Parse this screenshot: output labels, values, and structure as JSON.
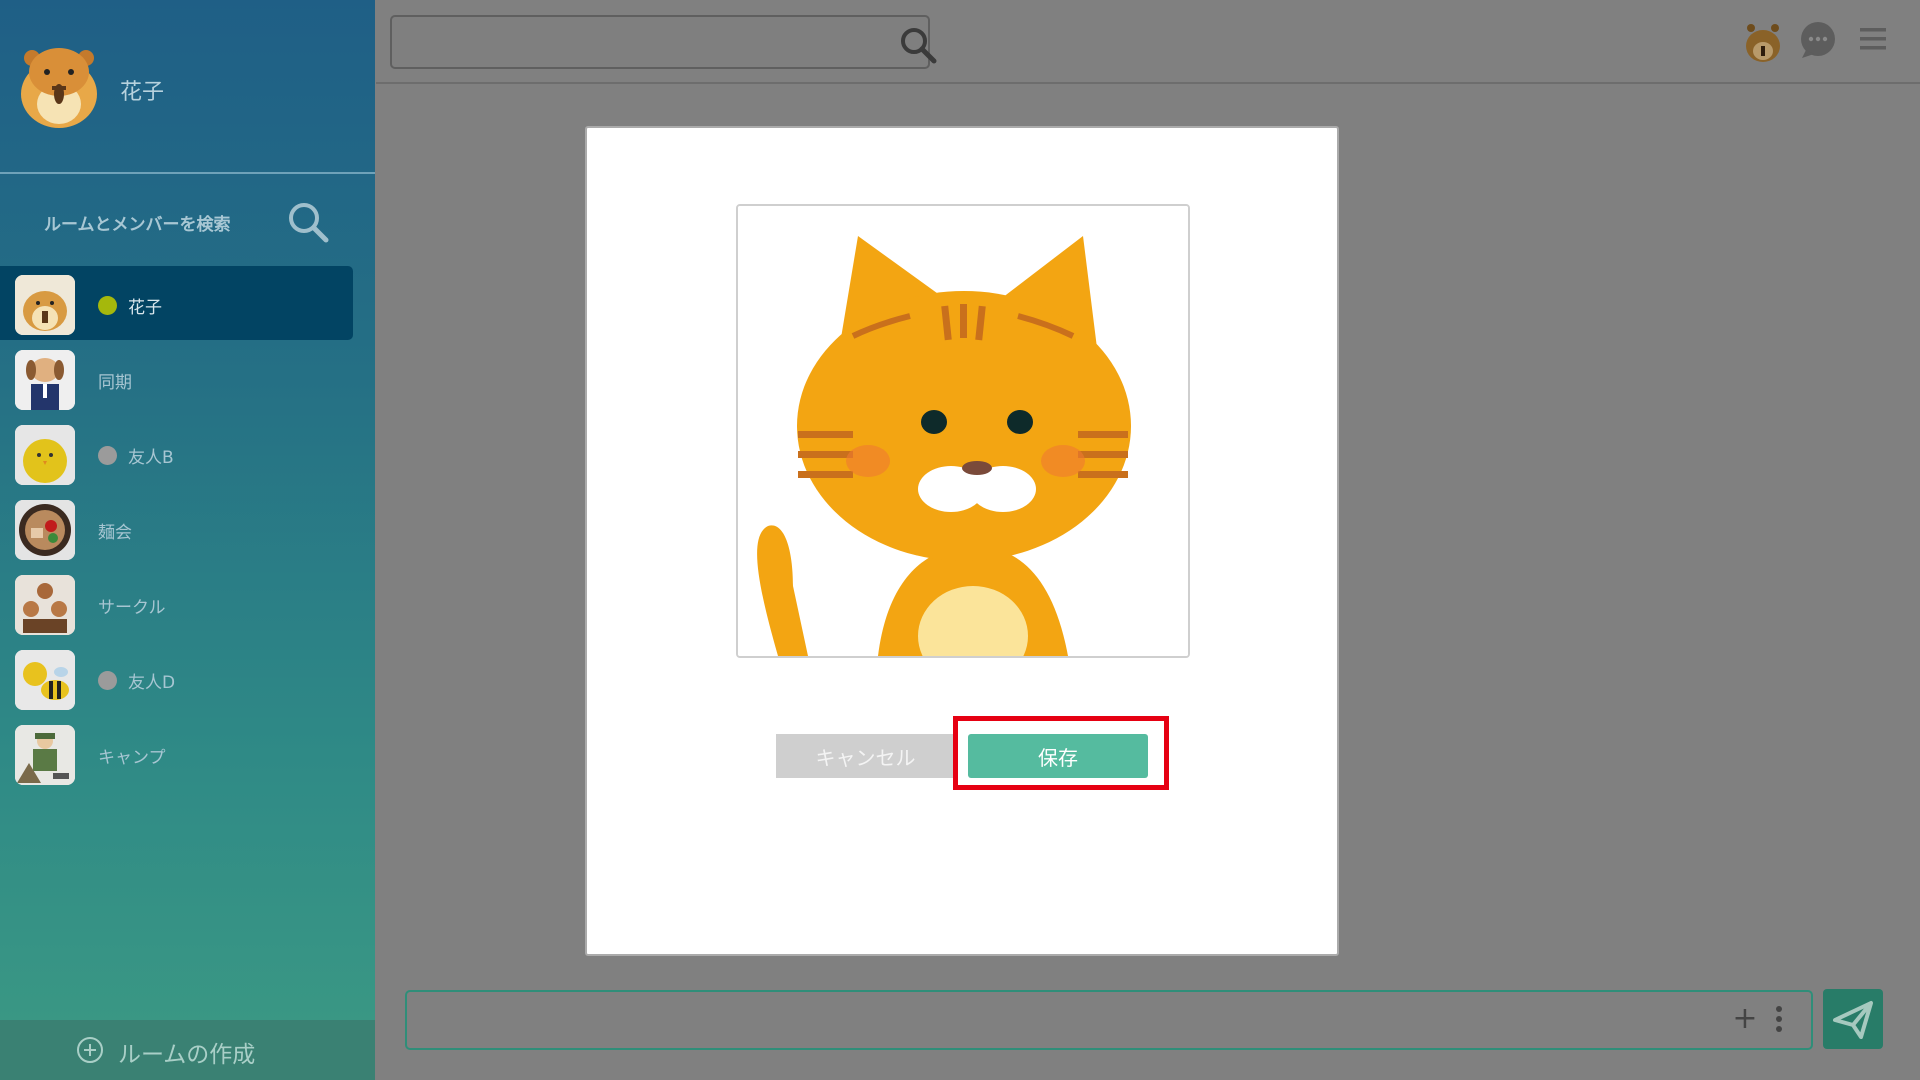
{
  "user": {
    "name": "花子"
  },
  "sidebar": {
    "search_label": "ルームとメンバーを検索",
    "rooms": [
      {
        "label": "花子",
        "status": "online",
        "active": true
      },
      {
        "label": "同期",
        "status": "none",
        "active": false
      },
      {
        "label": "友人B",
        "status": "offline",
        "active": false
      },
      {
        "label": "麺会",
        "status": "none",
        "active": false
      },
      {
        "label": "サークル",
        "status": "none",
        "active": false
      },
      {
        "label": "友人D",
        "status": "offline",
        "active": false
      },
      {
        "label": "キャンプ",
        "status": "none",
        "active": false
      }
    ],
    "create_room_label": "ルームの作成"
  },
  "topbar": {
    "search_placeholder": ""
  },
  "composer": {
    "placeholder": ""
  },
  "modal": {
    "cancel_label": "キャンセル",
    "save_label": "保存"
  },
  "colors": {
    "online": "#a5b80c",
    "offline": "#9b9b9b",
    "highlight": "#e60012",
    "save": "#55bb9f"
  }
}
